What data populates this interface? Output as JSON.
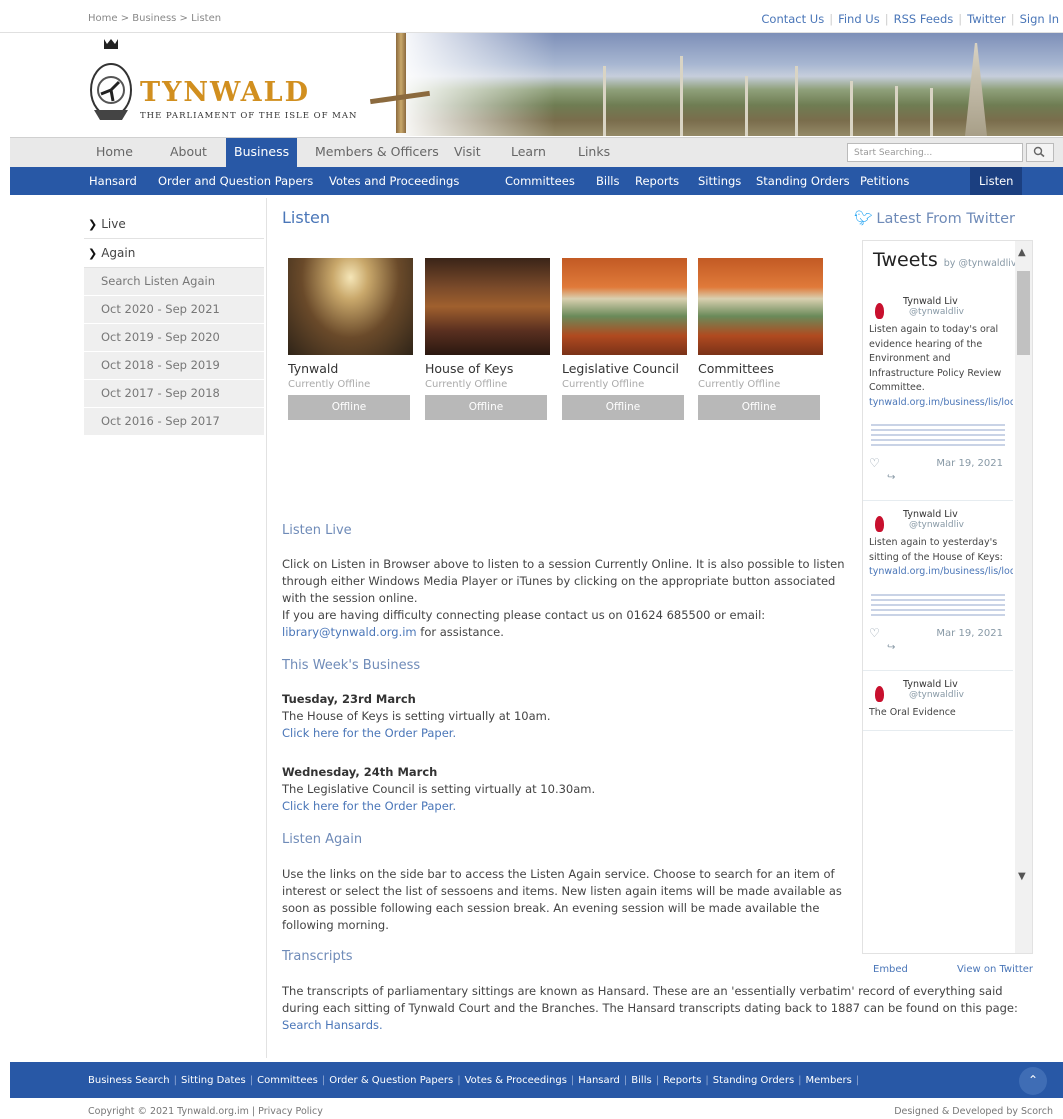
{
  "breadcrumb": "Home > Business > Listen",
  "top_links": [
    "Contact Us",
    "Find Us",
    "RSS Feeds",
    "Twitter",
    "Sign In"
  ],
  "logo": {
    "title": "TYNWALD",
    "subtitle": "THE PARLIAMENT OF THE ISLE OF MAN"
  },
  "main_nav": {
    "items": [
      "Home",
      "About",
      "Business",
      "Members & Officers",
      "Visit",
      "Learn",
      "Links"
    ],
    "active": "Business",
    "search_placeholder": "Start Searching..."
  },
  "sub_nav": {
    "items": [
      "Hansard",
      "Order and Question Papers",
      "Votes and Proceedings",
      "Committees",
      "Bills",
      "Reports",
      "Sittings",
      "Standing Orders",
      "Petitions",
      "Listen"
    ],
    "active": "Listen"
  },
  "sidebar": {
    "top_items": [
      "Live",
      "Again"
    ],
    "sub_items": [
      "Search Listen Again",
      "Oct 2020 - Sep 2021",
      "Oct 2019 - Sep 2020",
      "Oct 2018 - Sep 2019",
      "Oct 2017 - Sep 2018",
      "Oct 2016 - Sep 2017"
    ]
  },
  "page_title": "Listen",
  "chambers": [
    {
      "name": "Tynwald",
      "status": "Currently Offline",
      "button": "Offline"
    },
    {
      "name": "House of Keys",
      "status": "Currently Offline",
      "button": "Offline"
    },
    {
      "name": "Legislative Council",
      "status": "Currently Offline",
      "button": "Offline"
    },
    {
      "name": "Committees",
      "status": "Currently Offline",
      "button": "Offline"
    }
  ],
  "listen_live": {
    "heading": "Listen Live",
    "para": "Click on Listen in Browser above to listen to a session Currently Online. It is also possible to listen through either Windows Media Player or iTunes by clicking on the appropriate button associated with the session online.",
    "contact": "If you are having difficulty connecting please contact us on 01624 685500 or email:",
    "email": "library@tynwald.org.im",
    "assist": "for assistance."
  },
  "this_week": {
    "heading": "This Week's Business",
    "days": [
      {
        "date": "Tuesday, 23rd March",
        "text": "The House of Keys is setting virtually at 10am.",
        "link": "Click here for the Order Paper."
      },
      {
        "date": "Wednesday, 24th March",
        "text": "The Legislative Council is setting virtually at 10.30am.",
        "link": "Click here for the Order Paper."
      }
    ]
  },
  "listen_again": {
    "heading": "Listen Again",
    "para": "Use the links on the side bar to access the Listen Again service. Choose to search for an item of interest or select the list of sessoens and items. New listen again items will be made available as soon as possible following each session break. An evening session will be made available the following morning."
  },
  "transcripts": {
    "heading": "Transcripts",
    "para": "The transcripts of parliamentary sittings are known as Hansard. These are an 'essentially verbatim' record of everything said during each sitting of Tynwald Court and the Branches. The Hansard transcripts dating back to 1887 can be found on this page:",
    "link": "Search Hansards."
  },
  "twitter": {
    "heading": "Latest From Twitter",
    "widget_title": "Tweets",
    "by": "by @tynwaldlive",
    "tweets": [
      {
        "name": "Tynwald Liv",
        "handle": "@tynwaldliv",
        "text": "Listen again to today's oral evidence hearing of the Environment and Infrastructure Policy Review Committee.",
        "link": "tynwald.org.im/business/lis/lode...",
        "date": "Mar 19, 2021"
      },
      {
        "name": "Tynwald Liv",
        "handle": "@tynwaldliv",
        "text": "Listen again to yesterday's sitting of the House of Keys:",
        "link": "tynwald.org.im/business/lis/lode...",
        "date": "Mar 19, 2021"
      },
      {
        "name": "Tynwald Liv",
        "handle": "@tynwaldliv",
        "text": "The Oral Evidence",
        "link": "",
        "date": ""
      }
    ],
    "embed": "Embed",
    "view": "View on Twitter"
  },
  "footer": {
    "links": [
      "Business Search",
      "Sitting Dates",
      "Committees",
      "Order & Question Papers",
      "Votes & Proceedings",
      "Hansard",
      "Bills",
      "Reports",
      "Standing Orders",
      "Members"
    ],
    "copyright": "Copyright © 2021 Tynwald.org.im | Privacy Policy",
    "designed": "Designed & Developed by Scorch"
  },
  "colors": {
    "brand_blue": "#2858a6",
    "logo_gold": "#d18f1f",
    "link_blue": "#4a76b8"
  }
}
